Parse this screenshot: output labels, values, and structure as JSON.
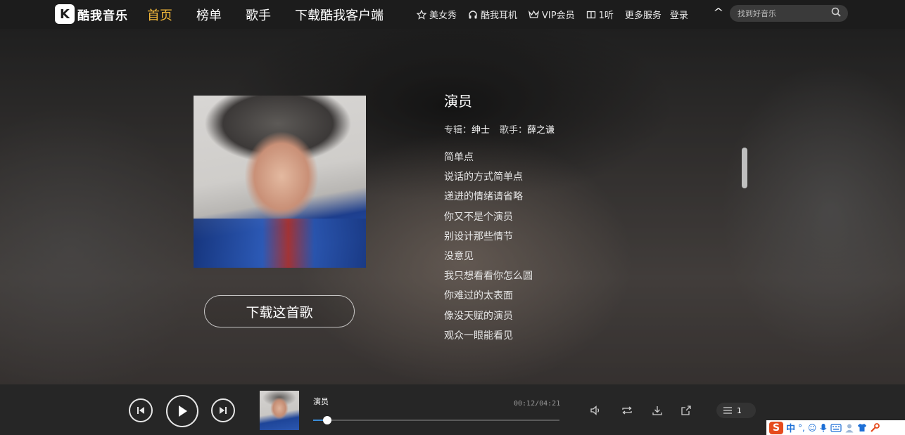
{
  "header": {
    "logo_text": "酷我音乐",
    "logo_mark": "K",
    "nav": [
      {
        "label": "首页",
        "active": true
      },
      {
        "label": "榜单",
        "active": false
      },
      {
        "label": "歌手",
        "active": false
      },
      {
        "label": "下载酷我客户端",
        "active": false
      }
    ],
    "links": [
      {
        "icon": "star-outline-icon",
        "label": "美女秀"
      },
      {
        "icon": "headphones-icon",
        "label": "酷我耳机"
      },
      {
        "icon": "crown-icon",
        "label": "VIP会员"
      },
      {
        "icon": "box-icon",
        "label": "1听"
      }
    ],
    "more_services": "更多服务",
    "login": "登录",
    "search_placeholder": "找到好音乐"
  },
  "song": {
    "title": "演员",
    "album_label": "专辑：",
    "album": "绅士",
    "artist_label": "歌手：",
    "artist": "薛之谦",
    "download_button": "下载这首歌",
    "lyrics": [
      "简单点",
      "说话的方式简单点",
      "递进的情绪请省略",
      "你又不是个演员",
      "别设计那些情节",
      "没意见",
      "我只想看看你怎么圆",
      "你难过的太表面",
      "像没天赋的演员",
      "观众一眼能看见"
    ]
  },
  "player": {
    "title": "演员",
    "time": "00:12/04:21",
    "progress": 0.057,
    "playlist_count": "1"
  },
  "ime": {
    "logo": "S",
    "mode": "中"
  },
  "colors": {
    "accent": "#f4b93a",
    "progress": "#3c8dd8",
    "topbar": "#1c1c1c",
    "player": "#262626"
  }
}
